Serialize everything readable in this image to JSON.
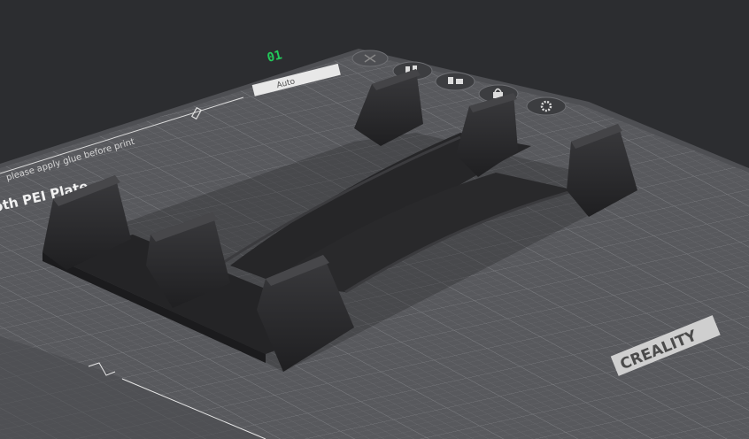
{
  "plate": {
    "number": "01",
    "name_label": "oth PEI Plate",
    "hint": "please apply glue before print",
    "auto_label": "Auto",
    "brand": "CREALITY"
  },
  "toolbar": {
    "close_icon": "close-icon",
    "arrange_icon": "arrange-icon",
    "orient_icon": "orient-icon",
    "lock_icon": "lock-icon",
    "settings_icon": "gear-icon"
  },
  "colors": {
    "background": "#2c2d30",
    "plate": "#5a5b5f",
    "grid": "#6e6f73",
    "plate_number": "#22c95a",
    "model": "#2a2a2c"
  }
}
